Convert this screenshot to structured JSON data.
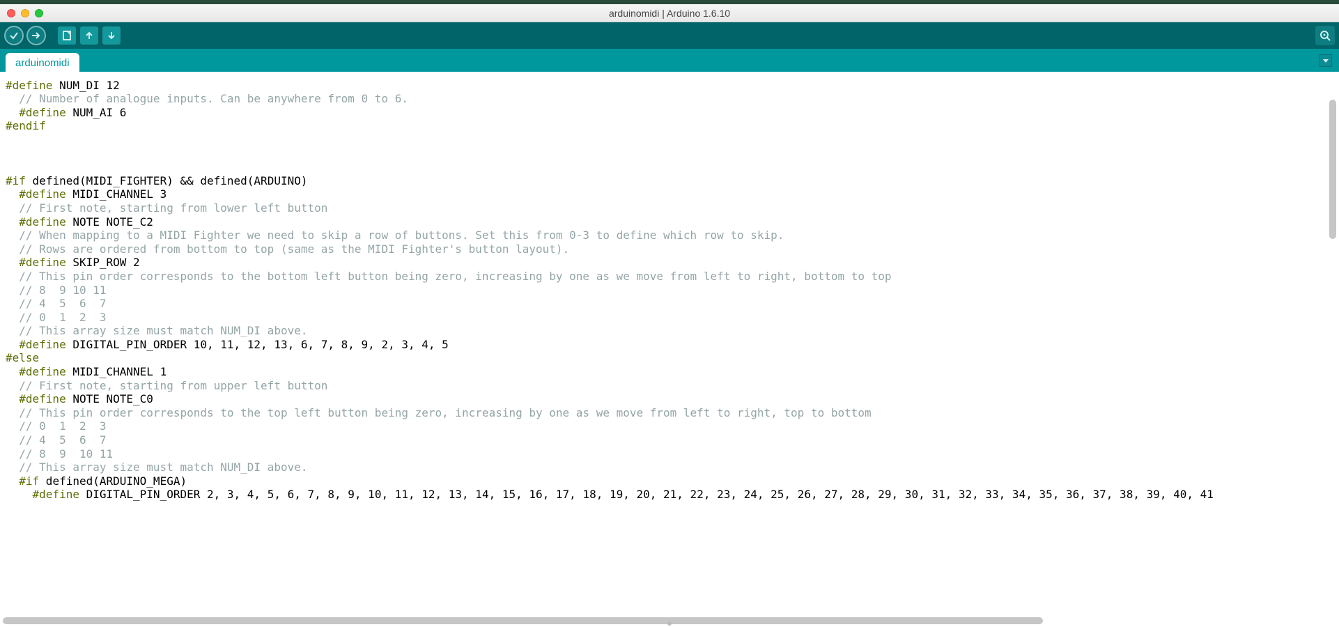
{
  "window": {
    "title": "arduinomidi | Arduino 1.6.10"
  },
  "tab": {
    "name": "arduinomidi"
  },
  "toolbar": {
    "verify": "verify-button",
    "upload": "upload-button",
    "new": "new-button",
    "open": "open-button",
    "save": "save-button",
    "serial": "serial-monitor-button"
  },
  "colors": {
    "teal": "#00979d",
    "dark_teal": "#006468",
    "preproc": "#5e6d03",
    "comment": "#95a5a6"
  },
  "code": {
    "l00a": "#define",
    "l00b": " NUM_DI 12",
    "l01": "  // Number of analogue inputs. Can be anywhere from 0 to 6.",
    "l02a": "  #define",
    "l02b": " NUM_AI 6",
    "l03": "#endif",
    "l04": "",
    "l05": "",
    "l06": "",
    "l07a": "#if",
    "l07b": " defined(MIDI_FIGHTER) && defined(ARDUINO)",
    "l08a": "  #define",
    "l08b": " MIDI_CHANNEL 3",
    "l09": "  // First note, starting from lower left button",
    "l10a": "  #define",
    "l10b": " NOTE NOTE_C2",
    "l11": "  // When mapping to a MIDI Fighter we need to skip a row of buttons. Set this from 0-3 to define which row to skip.",
    "l12": "  // Rows are ordered from bottom to top (same as the MIDI Fighter's button layout).",
    "l13a": "  #define",
    "l13b": " SKIP_ROW 2",
    "l14": "  // This pin order corresponds to the bottom left button being zero, increasing by one as we move from left to right, bottom to top",
    "l15": "  // 8  9 10 11",
    "l16": "  // 4  5  6  7",
    "l17": "  // 0  1  2  3",
    "l18": "  // This array size must match NUM_DI above.",
    "l19a": "  #define",
    "l19b": " DIGITAL_PIN_ORDER 10, 11, 12, 13, 6, 7, 8, 9, 2, 3, 4, 5",
    "l20": "#else",
    "l21a": "  #define",
    "l21b": " MIDI_CHANNEL 1",
    "l22": "  // First note, starting from upper left button",
    "l23a": "  #define",
    "l23b": " NOTE NOTE_C0",
    "l24": "  // This pin order corresponds to the top left button being zero, increasing by one as we move from left to right, top to bottom",
    "l25": "  // 0  1  2  3",
    "l26": "  // 4  5  6  7",
    "l27": "  // 8  9  10 11",
    "l28": "  // This array size must match NUM_DI above.",
    "l29a": "  #if",
    "l29b": " defined(ARDUINO_MEGA)",
    "l30a": "    #define",
    "l30b": " DIGITAL_PIN_ORDER 2, 3, 4, 5, 6, 7, 8, 9, 10, 11, 12, 13, 14, 15, 16, 17, 18, 19, 20, 21, 22, 23, 24, 25, 26, 27, 28, 29, 30, 31, 32, 33, 34, 35, 36, 37, 38, 39, 40, 41"
  }
}
